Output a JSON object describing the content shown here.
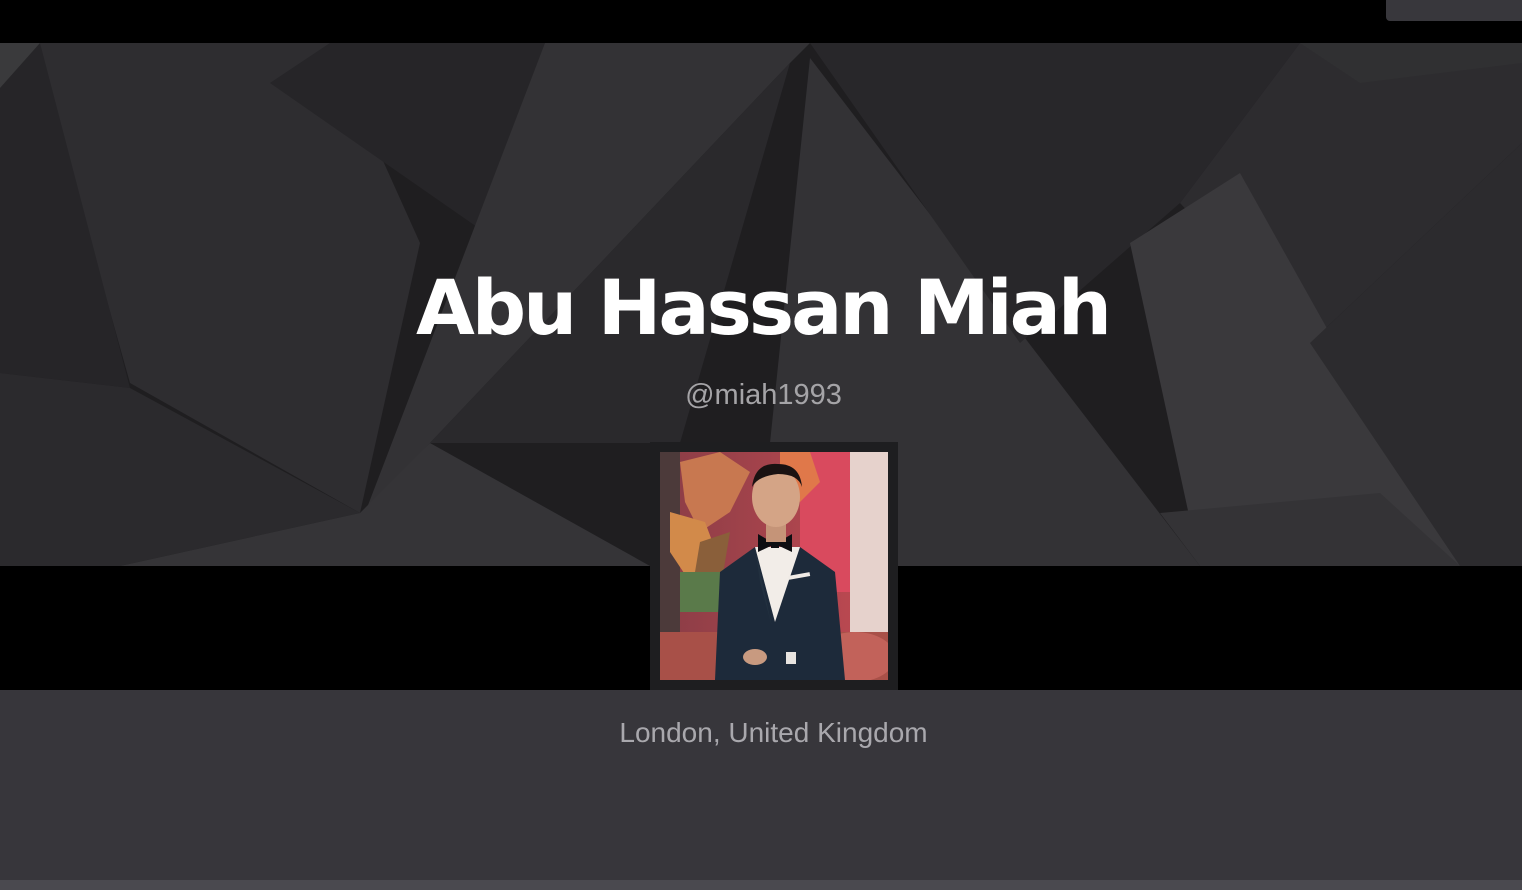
{
  "profile": {
    "name": "Abu Hassan Miah",
    "handle": "@miah1993",
    "location": "London, United Kingdom"
  },
  "colors": {
    "topbar": "#000000",
    "hero_background": "#1f1e20",
    "band": "#000000",
    "lower_background": "#37363b",
    "name_text": "#ffffff",
    "secondary_text": "#a5a4a7"
  }
}
